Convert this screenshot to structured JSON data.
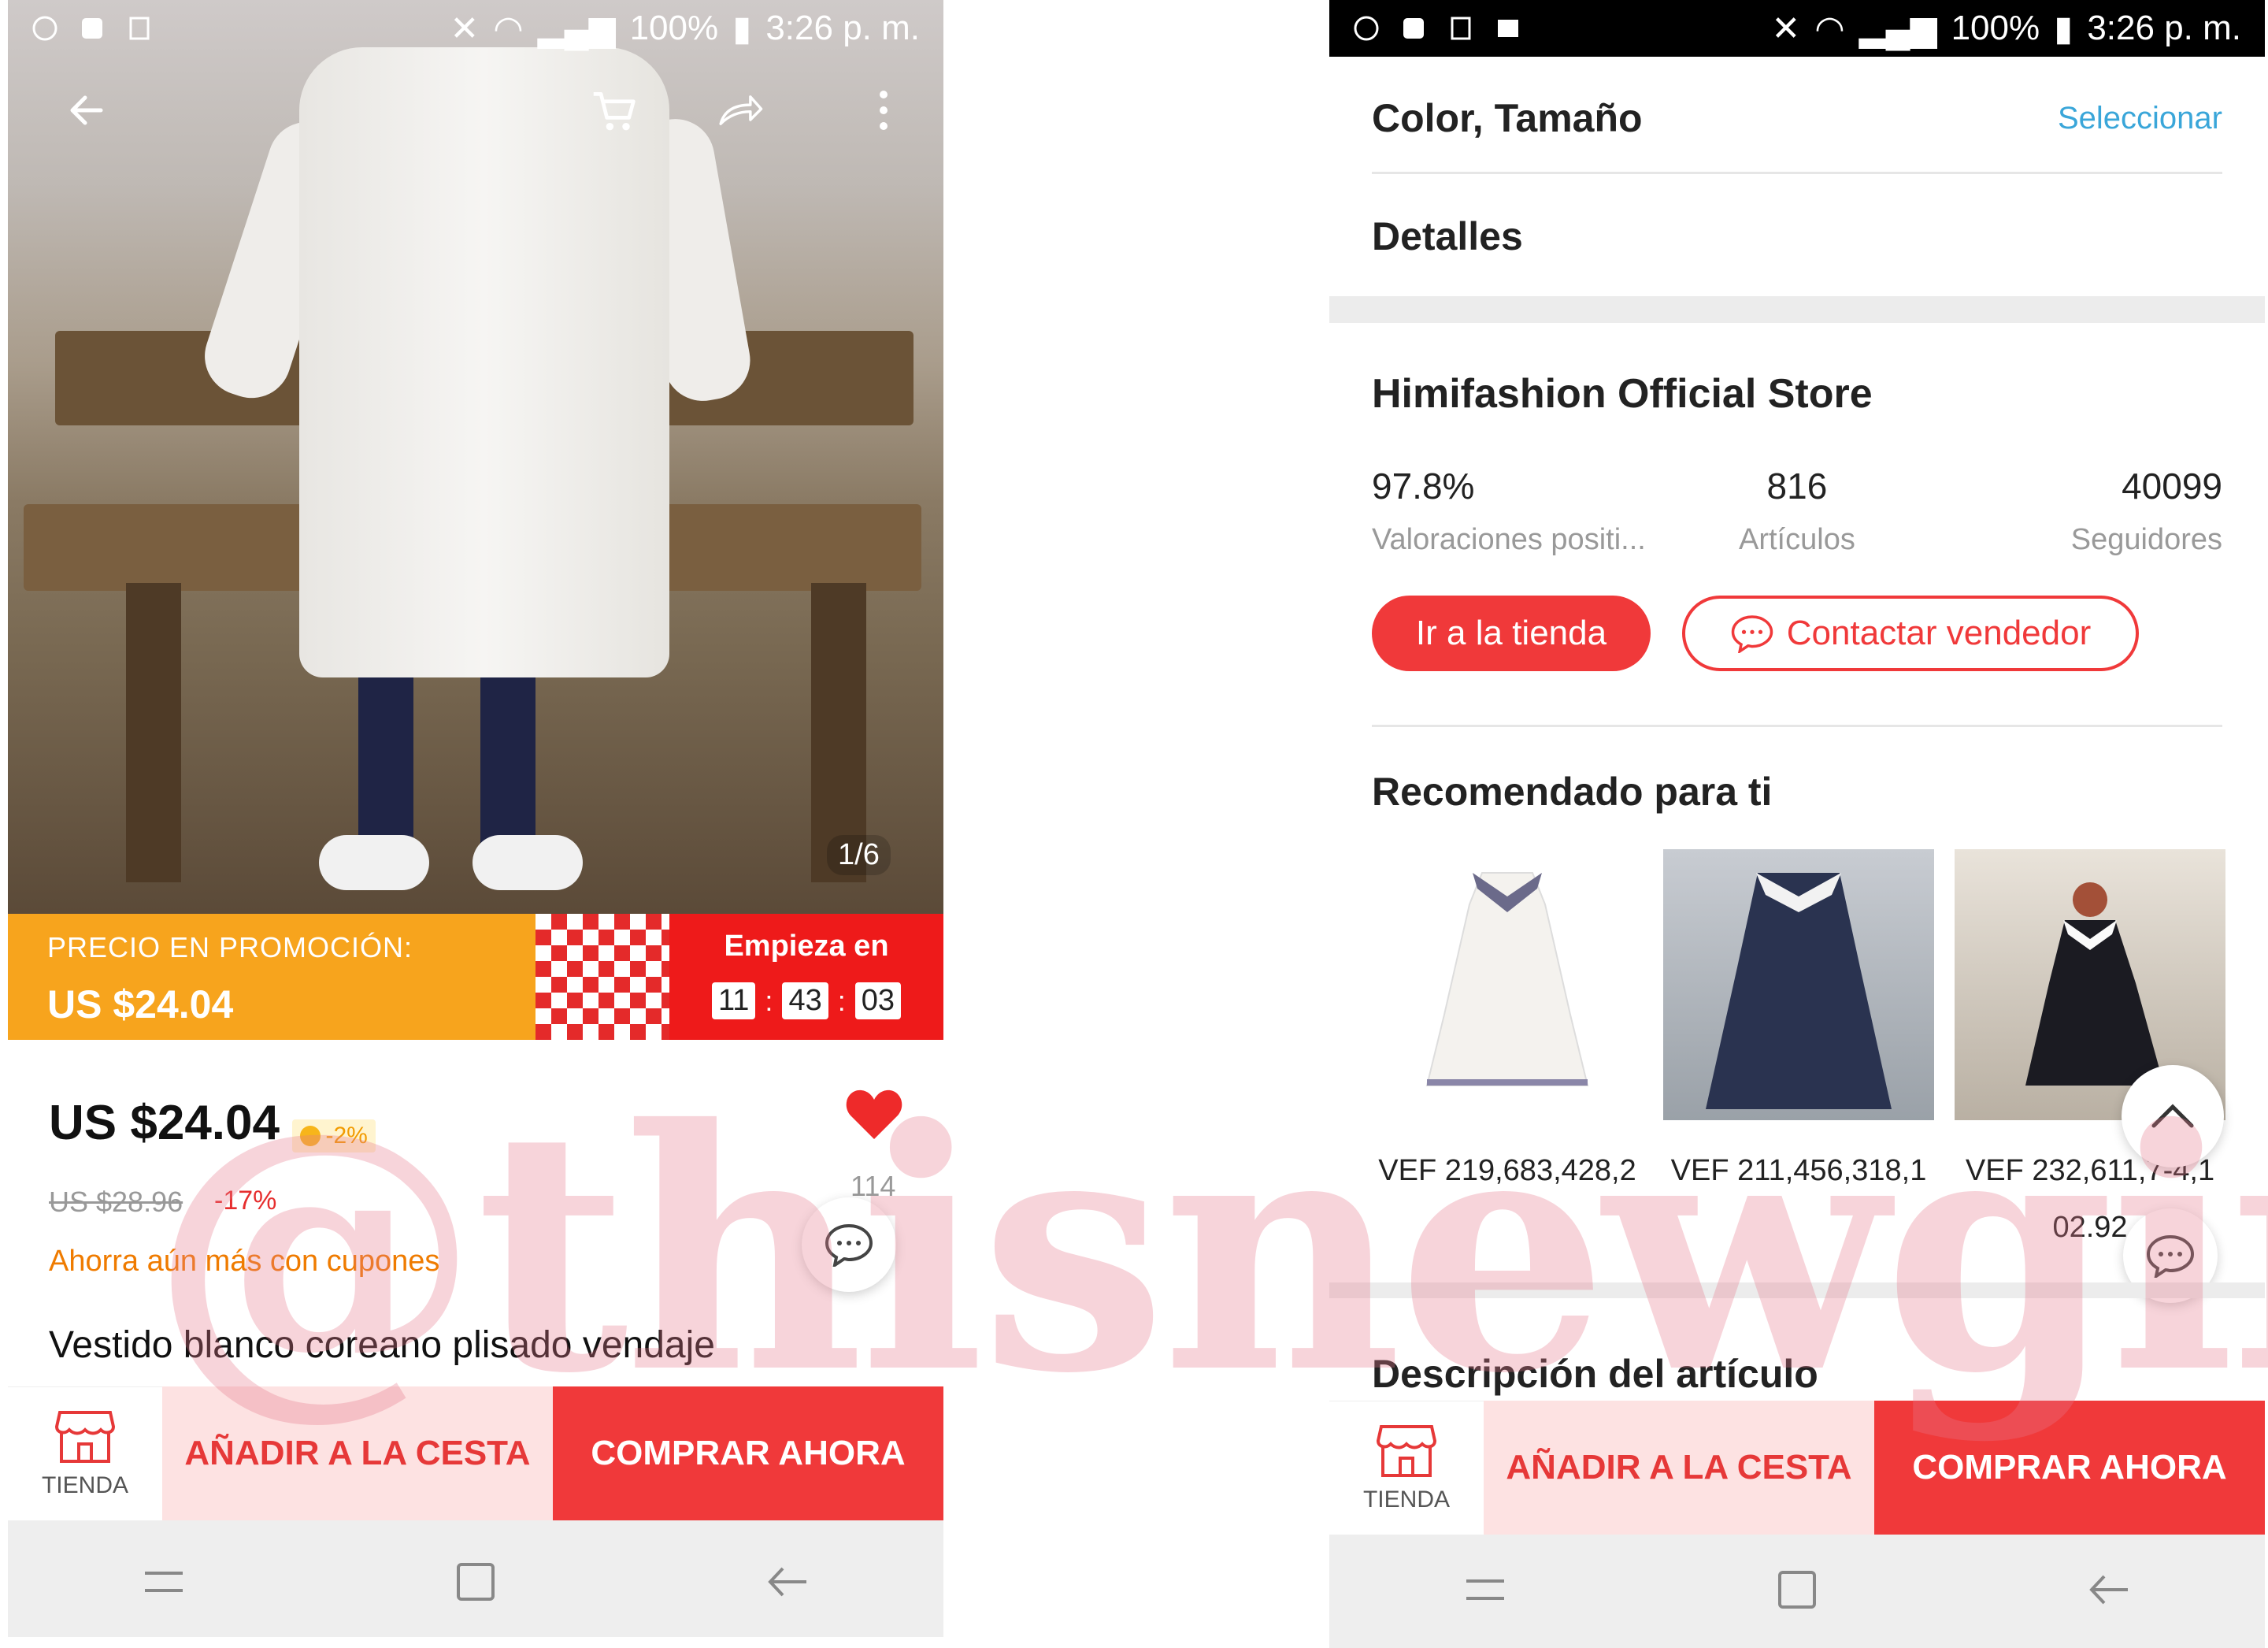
{
  "status_bar": {
    "battery": "100%",
    "time": "3:26 p. m."
  },
  "left": {
    "image_counter": "1/6",
    "promo": {
      "label": "PRECIO EN PROMOCIÓN:",
      "price": "US $24.04",
      "starts_label": "Empieza en",
      "timer": [
        "11",
        "43",
        "03"
      ]
    },
    "price": "US $24.04",
    "coin_discount": "-2%",
    "old_price": "US $28.96",
    "discount": "-17%",
    "wish_count": "114",
    "coupon_text": "Ahorra aún más con cupones",
    "title": "Vestido blanco coreano plisado vendaje"
  },
  "right": {
    "color_size_label": "Color, Tamaño",
    "select_link": "Seleccionar",
    "details_label": "Detalles",
    "store_name": "Himifashion Official Store",
    "stats": [
      {
        "value": "97.8%",
        "label": "Valoraciones positi..."
      },
      {
        "value": "816",
        "label": "Artículos"
      },
      {
        "value": "40099",
        "label": "Seguidores"
      }
    ],
    "go_store": "Ir a la tienda",
    "contact_seller": "Contactar vendedor",
    "recommended_title": "Recomendado para ti",
    "recommended": [
      {
        "price": "VEF 219,683,428,2"
      },
      {
        "price": "VEF 211,456,318,1"
      },
      {
        "price": "VEF 232,611,7-4,1 02.92"
      }
    ],
    "description_title": "Descripción del artículo"
  },
  "action_bar": {
    "store_label": "TIENDA",
    "add_to_cart": "AÑADIR A LA CESTA",
    "buy_now": "COMPRAR AHORA"
  },
  "watermark": "@thisnewgirl",
  "colors": {
    "accent_red": "#f0393a",
    "promo_orange": "#f7a41d",
    "link_blue": "#3aa6d9"
  }
}
